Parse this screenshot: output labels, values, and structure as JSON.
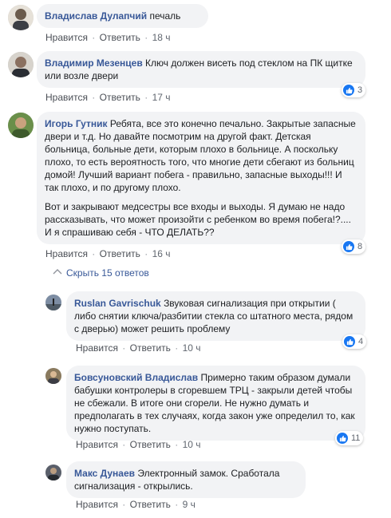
{
  "comments": [
    {
      "author": "Владислав Дулапчий",
      "text": "печаль",
      "like_label": "Нравится",
      "reply_label": "Ответить",
      "time": "18 ч",
      "reactions": ""
    },
    {
      "author": "Владимир Мезенцев",
      "text": "Ключ должен висеть под стеклом на ПК щитке или возле двери",
      "like_label": "Нравится",
      "reply_label": "Ответить",
      "time": "17 ч",
      "reactions": "3"
    },
    {
      "author": "Игорь Гутник",
      "text": "Ребята, все это конечно печально. Закрытые запасные двери и т.д. Но давайте посмотрим на другой факт. Детская больница, больные дети, которым плохо в больнице. А поскольку плохо, то есть вероятность того, что многие дети сбегают из больниц домой! Лучший вариант побега - правильно, запасные выходы!!! И так плохо, и по другому плохо.",
      "text2": "Вот и закрывают медсестры все входы и выходы. Я думаю не надо рассказывать, что может произойти с ребенком во время побега!?.... И я спрашиваю себя - ЧТО ДЕЛАТЬ??",
      "like_label": "Нравится",
      "reply_label": "Ответить",
      "time": "16 ч",
      "reactions": "8",
      "hide_replies": "Скрыть 15 ответов"
    }
  ],
  "replies": [
    {
      "author": "Ruslan Gavrischuk",
      "text": "Звуковая сигнализация при открытии ( либо снятии ключа/разбитии стекла со штатного места, рядом с дверью) может решить проблему",
      "like_label": "Нравится",
      "reply_label": "Ответить",
      "time": "10 ч",
      "reactions": "4"
    },
    {
      "author": "Бовсуновский Владислав",
      "text": "Примерно таким образом думали бабушки контролеры в сгоревшем ТРЦ - закрыли детей чтобы не сбежали. В итоге они сгорели. Не нужно думать и предполагать в тех случаях, когда закон уже определил то, как нужно поступать.",
      "like_label": "Нравится",
      "reply_label": "Ответить",
      "time": "10 ч",
      "reactions": "11"
    },
    {
      "author": "Макс Дунаев",
      "text": "Электронный замок. Сработала сигнализация - открылись.",
      "like_label": "Нравится",
      "reply_label": "Ответить",
      "time": "9 ч",
      "reactions": ""
    }
  ],
  "dot_separator": "·",
  "colors": {
    "author": "#385898",
    "bubble": "#f2f3f5",
    "like": "#1877f2"
  },
  "icons": {
    "like": "thumbs-up-icon",
    "hide": "reply-arrow-icon"
  }
}
